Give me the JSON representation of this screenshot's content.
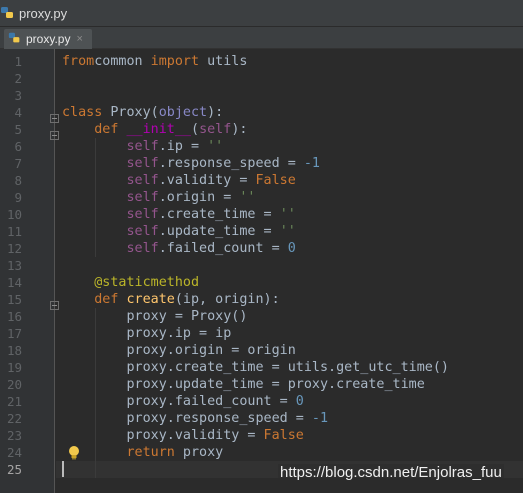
{
  "window": {
    "title": "proxy.py"
  },
  "tabs": [
    {
      "label": "proxy.py",
      "close": "×",
      "active": true
    }
  ],
  "editor": {
    "current_line": 25,
    "line_numbers": [
      "1",
      "2",
      "3",
      "4",
      "5",
      "6",
      "7",
      "8",
      "9",
      "10",
      "11",
      "12",
      "13",
      "14",
      "15",
      "16",
      "17",
      "18",
      "19",
      "20",
      "21",
      "22",
      "23",
      "24",
      "25"
    ],
    "lines": [
      [
        [
          "kw",
          "from"
        ],
        [
          "",
          "common"
        ],
        [
          "kw",
          " import"
        ],
        [
          "",
          " utils"
        ]
      ],
      [],
      [],
      [
        [
          "kw",
          "class"
        ],
        [
          "",
          " Proxy("
        ],
        [
          "builtin",
          "object"
        ],
        [
          "",
          "):"
        ]
      ],
      [
        [
          "",
          "    "
        ],
        [
          "kw",
          "def"
        ],
        [
          "",
          " "
        ],
        [
          "magic",
          "__init__"
        ],
        [
          "",
          "("
        ],
        [
          "self",
          "self"
        ],
        [
          "",
          "):"
        ]
      ],
      [
        [
          "",
          "        "
        ],
        [
          "self",
          "self"
        ],
        [
          "",
          ".ip = "
        ],
        [
          "str",
          "''"
        ]
      ],
      [
        [
          "",
          "        "
        ],
        [
          "self",
          "self"
        ],
        [
          "",
          ".response_speed = "
        ],
        [
          "num",
          "-1"
        ]
      ],
      [
        [
          "",
          "        "
        ],
        [
          "self",
          "self"
        ],
        [
          "",
          ".validity = "
        ],
        [
          "kw",
          "False"
        ]
      ],
      [
        [
          "",
          "        "
        ],
        [
          "self",
          "self"
        ],
        [
          "",
          ".origin = "
        ],
        [
          "str",
          "''"
        ]
      ],
      [
        [
          "",
          "        "
        ],
        [
          "self",
          "self"
        ],
        [
          "",
          ".create_time = "
        ],
        [
          "str",
          "''"
        ]
      ],
      [
        [
          "",
          "        "
        ],
        [
          "self",
          "self"
        ],
        [
          "",
          ".update_time = "
        ],
        [
          "str",
          "''"
        ]
      ],
      [
        [
          "",
          "        "
        ],
        [
          "self",
          "self"
        ],
        [
          "",
          ".failed_count = "
        ],
        [
          "num",
          "0"
        ]
      ],
      [],
      [
        [
          "",
          "    "
        ],
        [
          "dec",
          "@staticmethod"
        ]
      ],
      [
        [
          "",
          "    "
        ],
        [
          "kw",
          "def"
        ],
        [
          "",
          " "
        ],
        [
          "fn",
          "create"
        ],
        [
          "",
          "(ip, origin):"
        ]
      ],
      [
        [
          "",
          "        proxy = Proxy()"
        ]
      ],
      [
        [
          "",
          "        proxy.ip = ip"
        ]
      ],
      [
        [
          "",
          "        proxy.origin = origin"
        ]
      ],
      [
        [
          "",
          "        proxy.create_time = utils.get_utc_time()"
        ]
      ],
      [
        [
          "",
          "        proxy.update_time = proxy.create_time"
        ]
      ],
      [
        [
          "",
          "        proxy.failed_count = "
        ],
        [
          "num",
          "0"
        ]
      ],
      [
        [
          "",
          "        proxy.response_speed = "
        ],
        [
          "num",
          "-1"
        ]
      ],
      [
        [
          "",
          "        proxy.validity = "
        ],
        [
          "kw",
          "False"
        ]
      ],
      [
        [
          "",
          "        "
        ],
        [
          "kw",
          "return"
        ],
        [
          "",
          " proxy"
        ]
      ],
      []
    ]
  },
  "watermark": "https://blog.csdn.net/Enjolras_fuu",
  "colors": {
    "background": "#2b2b2b",
    "gutter": "#313335",
    "keyword": "#cc7832",
    "self": "#94558d",
    "number": "#6897bb",
    "string": "#6a8759",
    "decorator": "#bbb529",
    "default_text": "#a9b7c6"
  },
  "icons": [
    "python-file-icon",
    "close-icon",
    "fold-icon",
    "lightbulb-icon"
  ]
}
